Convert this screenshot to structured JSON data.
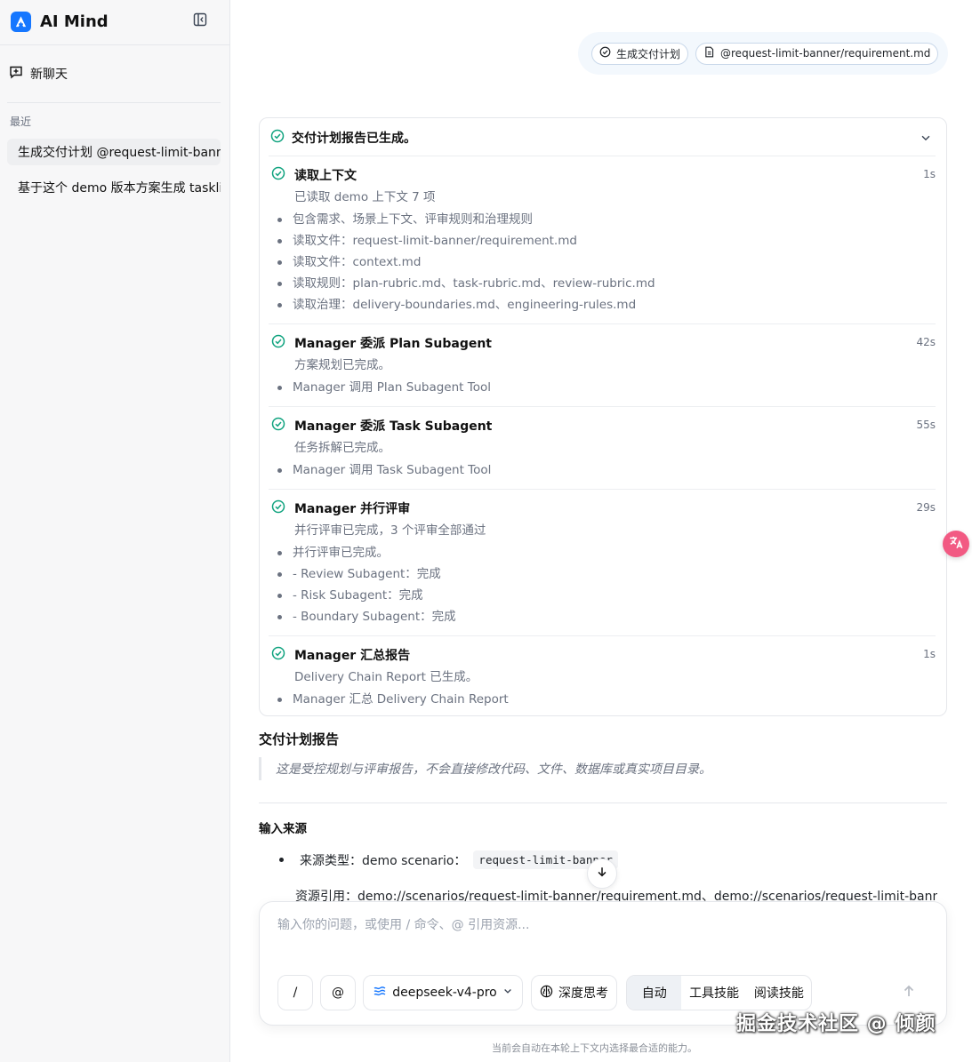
{
  "app": {
    "name": "AI Mind"
  },
  "sidebar": {
    "new_chat_label": "新聊天",
    "recent_label": "最近",
    "history": [
      {
        "label": "生成交付计划 @request-limit-banner/requirement.md"
      },
      {
        "label": "基于这个 demo 版本方案生成 tasklist"
      }
    ]
  },
  "context_chips": [
    {
      "icon": "check-circle-icon",
      "label": "生成交付计划"
    },
    {
      "icon": "document-icon",
      "label": "@request-limit-banner/requirement.md"
    }
  ],
  "steps_card": {
    "header": "交付计划报告已生成。",
    "steps": [
      {
        "title": "读取上下文",
        "time": "1s",
        "summary": "已读取 demo 上下文 7 项",
        "bullets": [
          "包含需求、场景上下文、评审规则和治理规则",
          "读取文件：request-limit-banner/requirement.md",
          "读取文件：context.md",
          "读取规则：plan-rubric.md、task-rubric.md、review-rubric.md",
          "读取治理：delivery-boundaries.md、engineering-rules.md"
        ]
      },
      {
        "title": "Manager 委派 Plan Subagent",
        "time": "42s",
        "summary": "方案规划已完成。",
        "bullets": [
          "Manager 调用 Plan Subagent Tool"
        ]
      },
      {
        "title": "Manager 委派 Task Subagent",
        "time": "55s",
        "summary": "任务拆解已完成。",
        "bullets": [
          "Manager 调用 Task Subagent Tool"
        ]
      },
      {
        "title": "Manager 并行评审",
        "time": "29s",
        "summary": "并行评审已完成，3 个评审全部通过",
        "bullets": [
          "并行评审已完成。",
          "- Review Subagent：完成",
          "- Risk Subagent：完成",
          "- Boundary Subagent：完成"
        ]
      },
      {
        "title": "Manager 汇总报告",
        "time": "1s",
        "summary": "Delivery Chain Report 已生成。",
        "bullets": [
          "Manager 汇总 Delivery Chain Report"
        ]
      }
    ]
  },
  "report": {
    "title": "交付计划报告",
    "quote": "这是受控规划与评审报告，不会直接修改代码、文件、数据库或真实项目目录。",
    "section_heading": "输入来源",
    "sources": [
      {
        "label": "来源类型：demo scenario：",
        "code": "request-limit-banner"
      },
      {
        "label": "资源引用：demo://scenarios/request-limit-banner/requirement.md、demo://scenarios/request-limit-banner/context.md"
      }
    ]
  },
  "composer": {
    "placeholder": "输入你的问题，或使用 / 命令、@ 引用资源...",
    "slash_label": "/",
    "at_label": "@",
    "model_label": "deepseek-v4-pro",
    "deep_think_label": "深度思考",
    "modes": [
      "自动",
      "工具技能",
      "阅读技能"
    ],
    "active_mode": "自动",
    "hint": "当前会自动在本轮上下文内选择最合适的能力。"
  },
  "watermark": "掘金技术社区 @ 倾颜",
  "colors": {
    "accent": "#1677ff",
    "success": "#10a37f",
    "muted": "#6b7280"
  }
}
